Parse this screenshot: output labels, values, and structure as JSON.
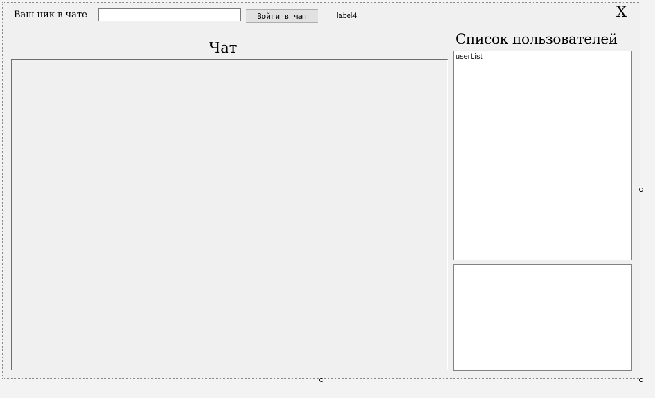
{
  "header": {
    "nick_label": "Ваш ник в чате",
    "nick_value": "",
    "login_button": "Войти в чат",
    "status_label": "label4",
    "close_label": "X"
  },
  "chat": {
    "title": "Чат"
  },
  "users": {
    "title": "Список пользователей",
    "list_items": [
      "userList"
    ]
  },
  "colors": {
    "form_background": "#f0f0f0",
    "button_background": "#e1e1e1",
    "list_background": "#ffffff"
  }
}
